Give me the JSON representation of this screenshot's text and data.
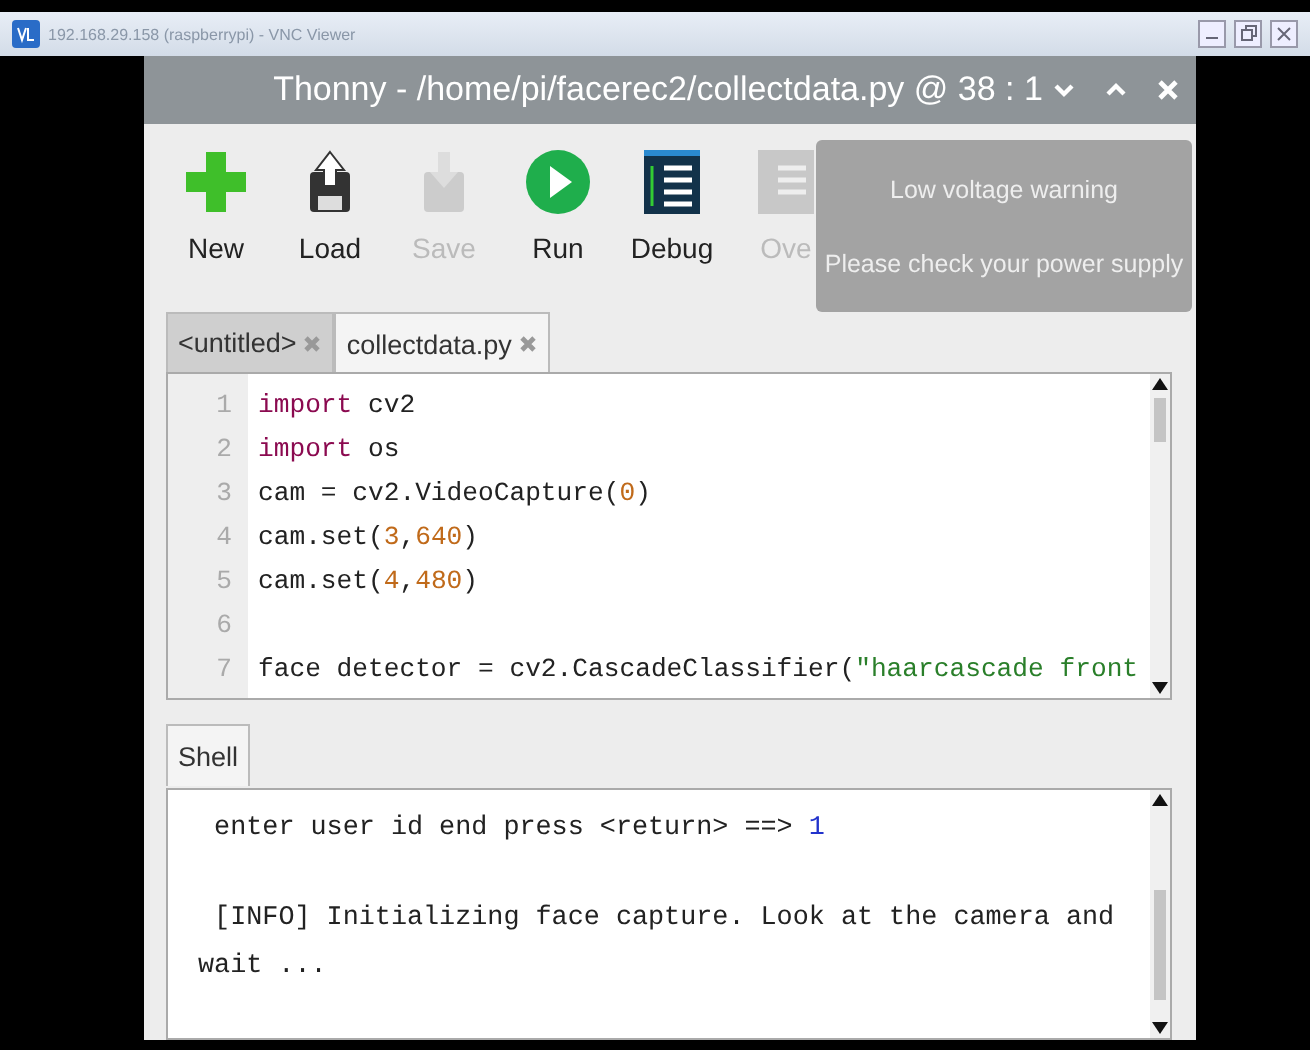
{
  "viewer": {
    "title": "192.168.29.158 (raspberrypi) - VNC Viewer"
  },
  "window": {
    "title": "Thonny  -  /home/pi/facerec2/collectdata.py  @  38 : 1"
  },
  "toolbar": [
    {
      "kind": "new",
      "label": "New",
      "disabled": false
    },
    {
      "kind": "load",
      "label": "Load",
      "disabled": false
    },
    {
      "kind": "save",
      "label": "Save",
      "disabled": true
    },
    {
      "kind": "run",
      "label": "Run",
      "disabled": false
    },
    {
      "kind": "debug",
      "label": "Debug",
      "disabled": false
    },
    {
      "kind": "over",
      "label": "Ove",
      "disabled": true
    }
  ],
  "notification": {
    "title": "Low voltage warning",
    "message": "Please check your power supply"
  },
  "editor_tabs": [
    {
      "label": "<untitled>",
      "selected": false
    },
    {
      "label": "collectdata.py",
      "selected": true
    }
  ],
  "editor": {
    "lines": [
      {
        "number": "1",
        "tokens": [
          {
            "kind": "keyword",
            "text": "import"
          },
          {
            "kind": "plain",
            "text": " cv2"
          }
        ]
      },
      {
        "number": "2",
        "tokens": [
          {
            "kind": "keyword",
            "text": "import"
          },
          {
            "kind": "plain",
            "text": " os"
          }
        ]
      },
      {
        "number": "3",
        "tokens": [
          {
            "kind": "plain",
            "text": "cam = cv2.VideoCapture("
          },
          {
            "kind": "number",
            "text": "0"
          },
          {
            "kind": "plain",
            "text": ")"
          }
        ]
      },
      {
        "number": "4",
        "tokens": [
          {
            "kind": "plain",
            "text": "cam.set("
          },
          {
            "kind": "number",
            "text": "3"
          },
          {
            "kind": "plain",
            "text": ","
          },
          {
            "kind": "number",
            "text": "640"
          },
          {
            "kind": "plain",
            "text": ")"
          }
        ]
      },
      {
        "number": "5",
        "tokens": [
          {
            "kind": "plain",
            "text": "cam.set("
          },
          {
            "kind": "number",
            "text": "4"
          },
          {
            "kind": "plain",
            "text": ","
          },
          {
            "kind": "number",
            "text": "480"
          },
          {
            "kind": "plain",
            "text": ")"
          }
        ]
      },
      {
        "number": "6"
      },
      {
        "number": "7",
        "tokens": [
          {
            "kind": "plain",
            "text": "face detector = cv2.CascadeClassifier("
          },
          {
            "kind": "string",
            "text": "\"haarcascade front"
          }
        ]
      }
    ]
  },
  "shell_tab": {
    "label": "Shell",
    "selected": true
  },
  "shell": {
    "lines": [
      {
        "tokens": [
          {
            "kind": "output",
            "text": " enter user id end press <return> ==> "
          },
          {
            "kind": "input",
            "text": "1"
          }
        ]
      },
      {
        "tokens": [
          {
            "kind": "output",
            "text": " [INFO] Initializing face capture. Look at the camera and wait ..."
          }
        ]
      }
    ]
  }
}
